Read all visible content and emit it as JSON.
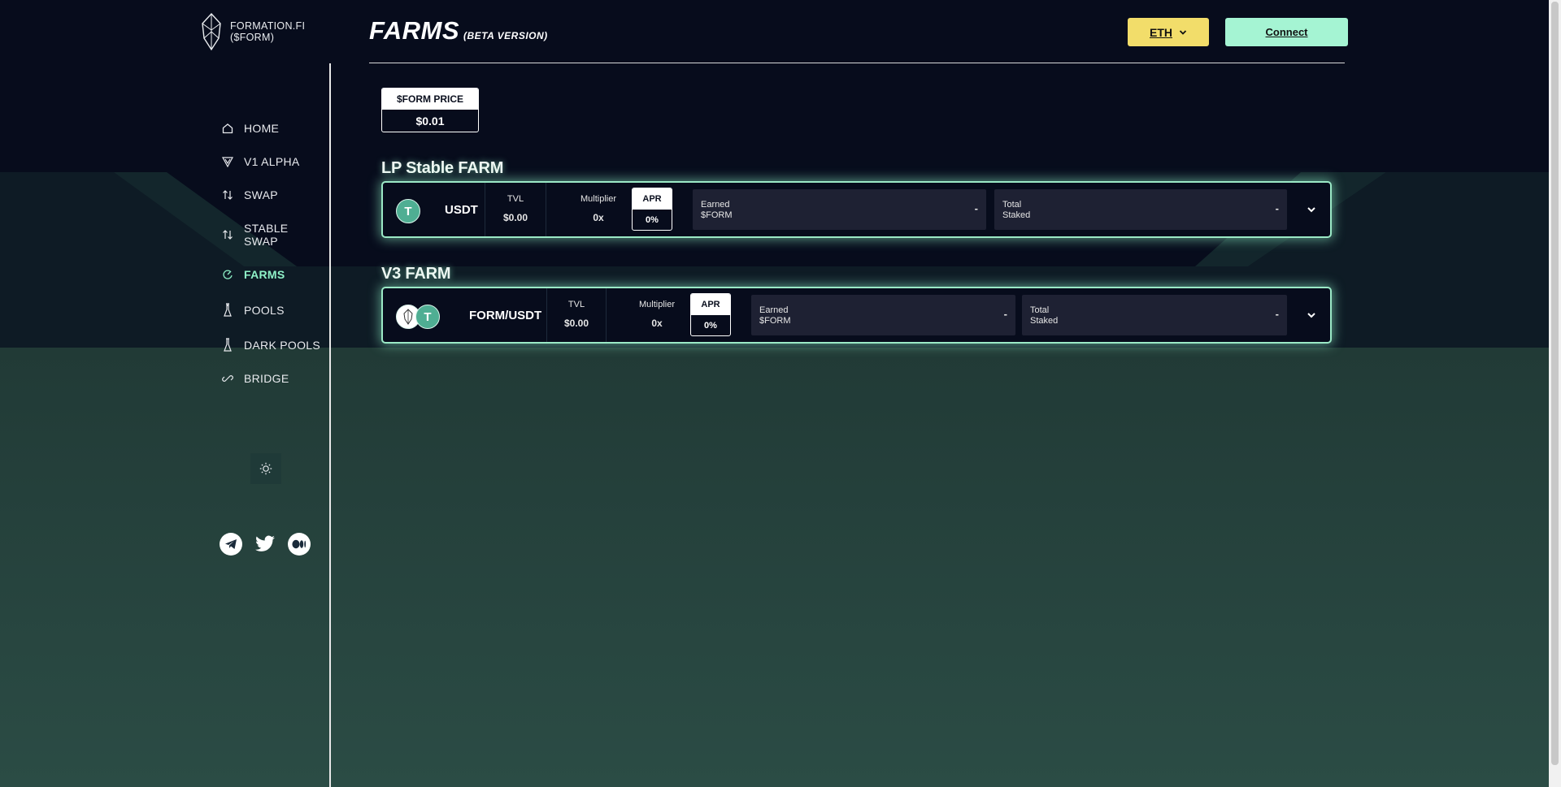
{
  "app": {
    "logo_text_line1": "FORMATION.FI",
    "logo_text_line2": "($FORM)"
  },
  "header": {
    "title": "FARMS",
    "subtitle": "(BETA VERSION)",
    "network_button": "ETH",
    "connect_button": "Connect"
  },
  "sidebar": {
    "items": [
      {
        "label": "HOME",
        "icon": "home-icon"
      },
      {
        "label": "V1 ALPHA",
        "icon": "v1-alpha-icon"
      },
      {
        "label": "SWAP",
        "icon": "swap-icon"
      },
      {
        "label": "STABLE SWAP",
        "icon": "stable-swap-icon"
      },
      {
        "label": "FARMS",
        "icon": "farms-icon",
        "active": true
      },
      {
        "label": "POOLS",
        "icon": "pools-icon"
      },
      {
        "label": "DARK POOLS",
        "icon": "dark-pools-icon"
      },
      {
        "label": "BRIDGE",
        "icon": "bridge-icon"
      }
    ],
    "theme_toggle_icon": "sun-icon",
    "socials": [
      "telegram-icon",
      "twitter-icon",
      "medium-icon"
    ]
  },
  "price": {
    "label": "$FORM PRICE",
    "value": "$0.01"
  },
  "farms": [
    {
      "section_title": "LP Stable FARM",
      "pair": "USDT",
      "tvl_label": "TVL",
      "tvl": "$0.00",
      "multiplier_label": "Multiplier",
      "multiplier": "0x",
      "apr_label": "APR",
      "apr": "0%",
      "earned_label": "Earned\n$FORM",
      "earned": "-",
      "staked_label": "Total\nStaked",
      "staked": "-"
    },
    {
      "section_title": "V3 FARM",
      "pair": "FORM/USDT",
      "tvl_label": "TVL",
      "tvl": "$0.00",
      "multiplier_label": "Multiplier",
      "multiplier": "0x",
      "apr_label": "APR",
      "apr": "0%",
      "earned_label": "Earned\n$FORM",
      "earned": "-",
      "staked_label": "Total\nStaked",
      "staked": "-"
    }
  ],
  "colors": {
    "accent": "#8ff2c8",
    "network_button": "#f2dd6a",
    "connect_button": "#a5f4d3",
    "background_dark": "#070c1c",
    "background_bottom": "#2a4a43"
  }
}
